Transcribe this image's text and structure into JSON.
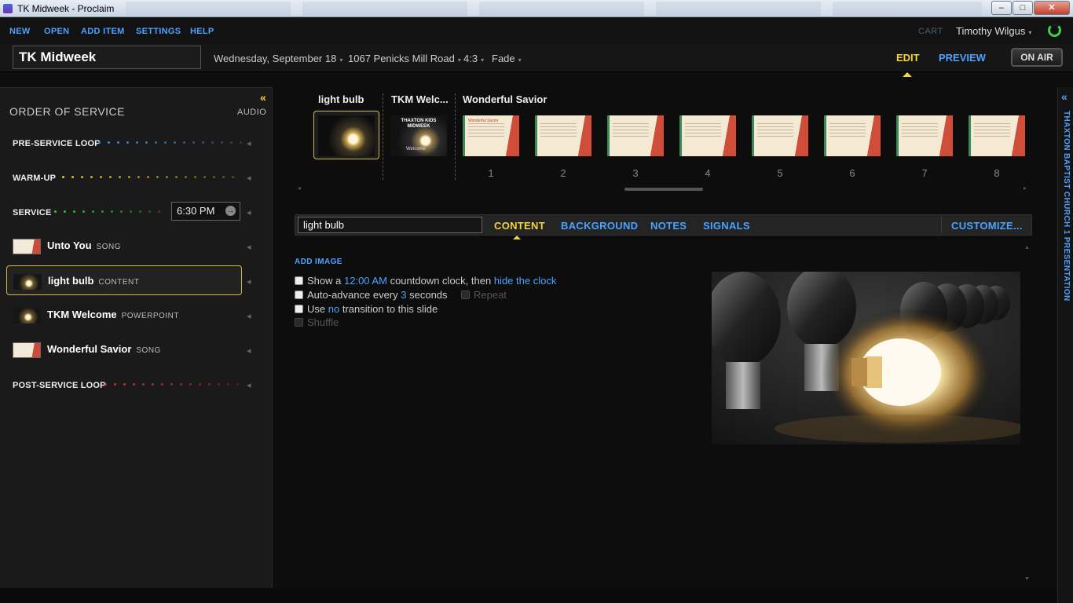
{
  "window": {
    "title": "TK Midweek - Proclaim",
    "min": "–",
    "max": "□",
    "close": "✕"
  },
  "menu": {
    "new": "NEW",
    "open": "OPEN",
    "add_item": "ADD ITEM",
    "settings": "SETTINGS",
    "help": "HELP"
  },
  "account": {
    "cart": "CART",
    "user": "Timothy Wilgus",
    "caret": "▾"
  },
  "header": {
    "title": "TK Midweek",
    "date": "Wednesday, September 18",
    "location": "1067 Penicks Mill Road",
    "aspect": "4:3",
    "transition": "Fade",
    "edit": "EDIT",
    "preview": "PREVIEW",
    "on_air": "ON AIR"
  },
  "order_of_service": {
    "collapse_icon": "«",
    "title": "ORDER OF SERVICE",
    "audio": "AUDIO",
    "segments": [
      {
        "label": "PRE-SERVICE LOOP",
        "color": "#3a8fe0"
      },
      {
        "label": "WARM-UP",
        "color": "#e3c62c"
      },
      {
        "label": "SERVICE",
        "color": "#2fc93a",
        "time": "6:30 PM",
        "go_icon": "→"
      },
      {
        "label": "POST-SERVICE LOOP",
        "color": "#e0302a"
      }
    ],
    "items": [
      {
        "name": "Unto You",
        "type": "SONG"
      },
      {
        "name": "light bulb",
        "type": "CONTENT"
      },
      {
        "name": "TKM Welcome",
        "type": "POWERPOINT"
      },
      {
        "name": "Wonderful Savior",
        "type": "SONG"
      }
    ],
    "speaker_icon": "◂"
  },
  "filmstrip": {
    "groups": [
      "light bulb",
      "TKM Welc...",
      "Wonderful Savior"
    ],
    "tkm_slide_title": "THAXTON KIDS MIDWEEK",
    "tkm_slide_sub": "Welcome",
    "song_slide_header": "Wonderful Savior",
    "slide_numbers": [
      "1",
      "2",
      "3",
      "4",
      "5",
      "6",
      "7",
      "8"
    ],
    "scroll_left": "◂",
    "scroll_right": "▸"
  },
  "item_editor": {
    "name": "light bulb",
    "tabs": [
      "CONTENT",
      "BACKGROUND",
      "NOTES",
      "SIGNALS"
    ],
    "customize": "CUSTOMIZE...",
    "add_image": "ADD IMAGE",
    "countdown": {
      "pre": "Show a",
      "time": "12:00 AM",
      "mid": "countdown clock, then",
      "action": "hide the clock"
    },
    "auto_advance": {
      "pre": "Auto-advance every",
      "value": "3",
      "post": "seconds"
    },
    "repeat": "Repeat",
    "transition": {
      "pre": "Use",
      "value": "no",
      "post": "transition to this slide"
    },
    "shuffle": "Shuffle",
    "scroll_up": "▲",
    "scroll_down": "▼"
  },
  "right_rail": {
    "collapse_icon": "«",
    "text": "THAXTON BAPTIST CHURCH 1 PRESENTATION"
  }
}
